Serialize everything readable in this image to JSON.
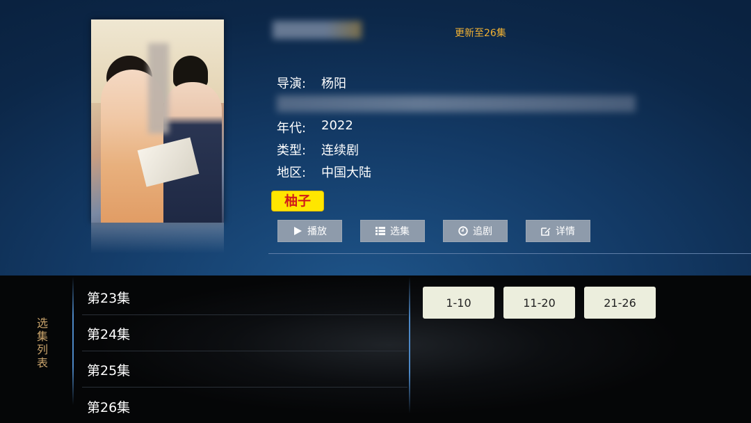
{
  "header": {
    "update_status": "更新至26集"
  },
  "info": {
    "director_label": "导演:",
    "director_value": "杨阳",
    "year_label": "年代:",
    "year_value": "2022",
    "type_label": "类型:",
    "type_value": "连续剧",
    "region_label": "地区:",
    "region_value": "中国大陆",
    "source_badge": "柚子"
  },
  "actions": {
    "play": "播放",
    "select_episode": "选集",
    "follow": "追剧",
    "details": "详情"
  },
  "episodes_panel": {
    "side_label": "选集列表",
    "episodes": [
      "第23集",
      "第24集",
      "第25集",
      "第26集"
    ],
    "ranges": [
      "1-10",
      "11-20",
      "21-26"
    ]
  },
  "colors": {
    "accent_orange": "#f2b233",
    "badge_yellow": "#ffe600",
    "badge_red": "#d11a1a",
    "button_gray": "#8e9bab",
    "line_blue": "#4d88c6"
  }
}
